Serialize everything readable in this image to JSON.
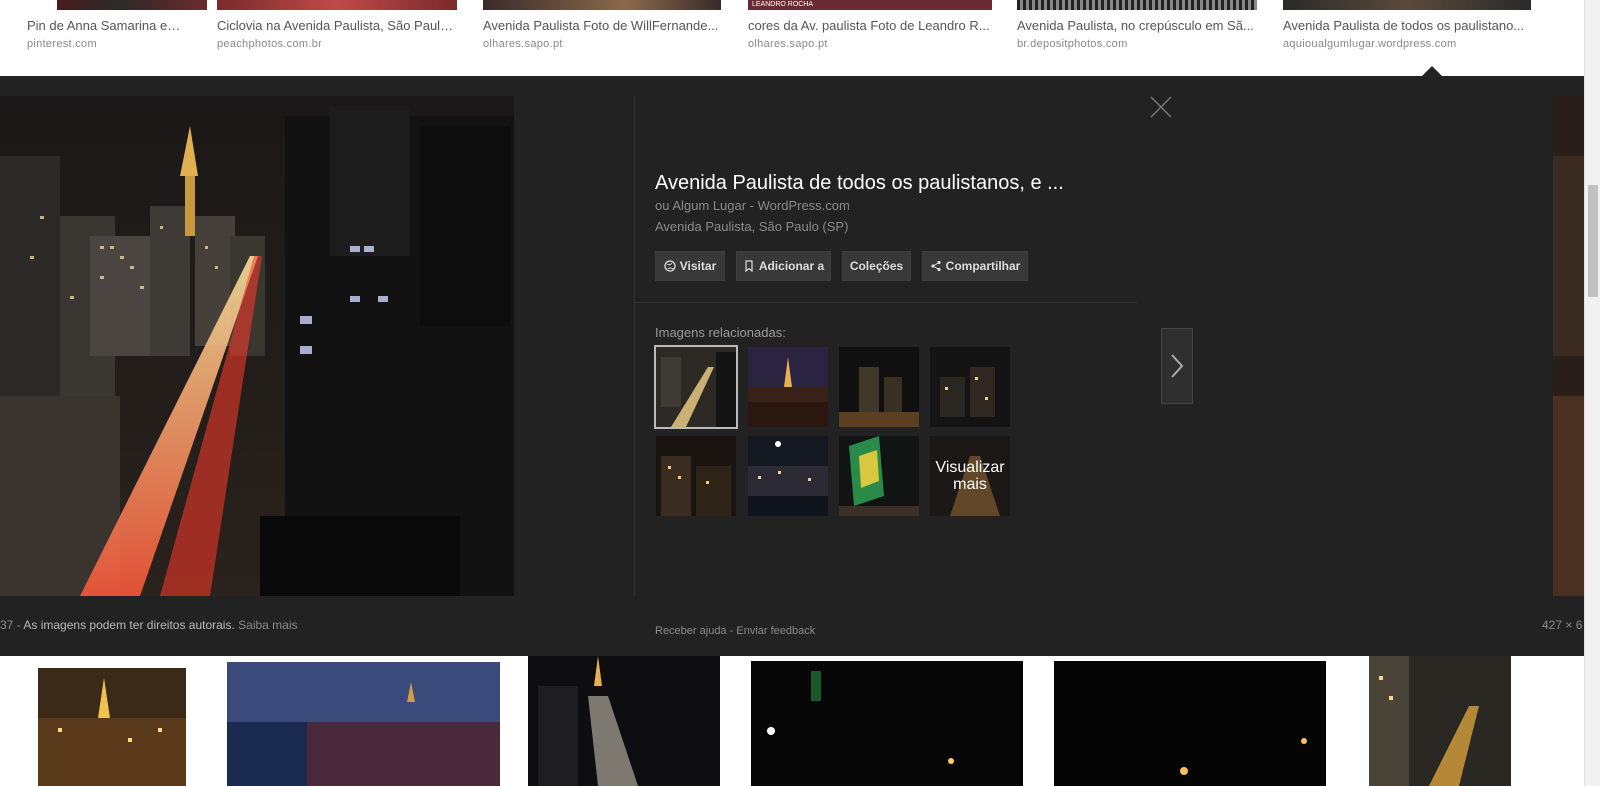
{
  "top_results": [
    {
      "caption": "Pin de Anna Samarina em...",
      "source": "pinterest.com"
    },
    {
      "caption": "Ciclovia na Avenida Paulista, São Paulo ...",
      "source": "peachphotos.com.br"
    },
    {
      "caption": "Avenida Paulista Foto de WillFernande...",
      "source": "olhares.sapo.pt"
    },
    {
      "caption": "cores da Av. paulista Foto de Leandro R...",
      "source": "olhares.sapo.pt"
    },
    {
      "caption": "Avenida Paulista, no crepúsculo em Sã...",
      "source": "br.depositphotos.com"
    },
    {
      "caption": "Avenida Paulista de todos os paulistano...",
      "source": "aquioualgumlugar.wordpress.com"
    }
  ],
  "top_thumb_watermark": "LEANDRO ROCHA",
  "panel": {
    "title": "Avenida Paulista de todos os paulistanos, e ...",
    "site": "ou Algum Lugar - WordPress.com",
    "description": "Avenida Paulista, São Paulo (SP)",
    "actions": {
      "visit": "Visitar",
      "add_to": "Adicionar a",
      "collections": "Coleções",
      "share": "Compartilhar"
    },
    "related_label": "Imagens relacionadas:",
    "see_more": "Visualizar mais",
    "footer": {
      "left_prefix": "37",
      "copyright": "As imagens podem ter direitos autorais.",
      "learn_more": "Saiba mais",
      "help": "Receber ajuda",
      "feedback": "Enviar feedback",
      "separator": "-",
      "dimensions": "427 × 6"
    }
  },
  "colors": {
    "panel_bg": "#222222",
    "button_bg": "#383838",
    "muted_text": "#8a8a8a"
  }
}
